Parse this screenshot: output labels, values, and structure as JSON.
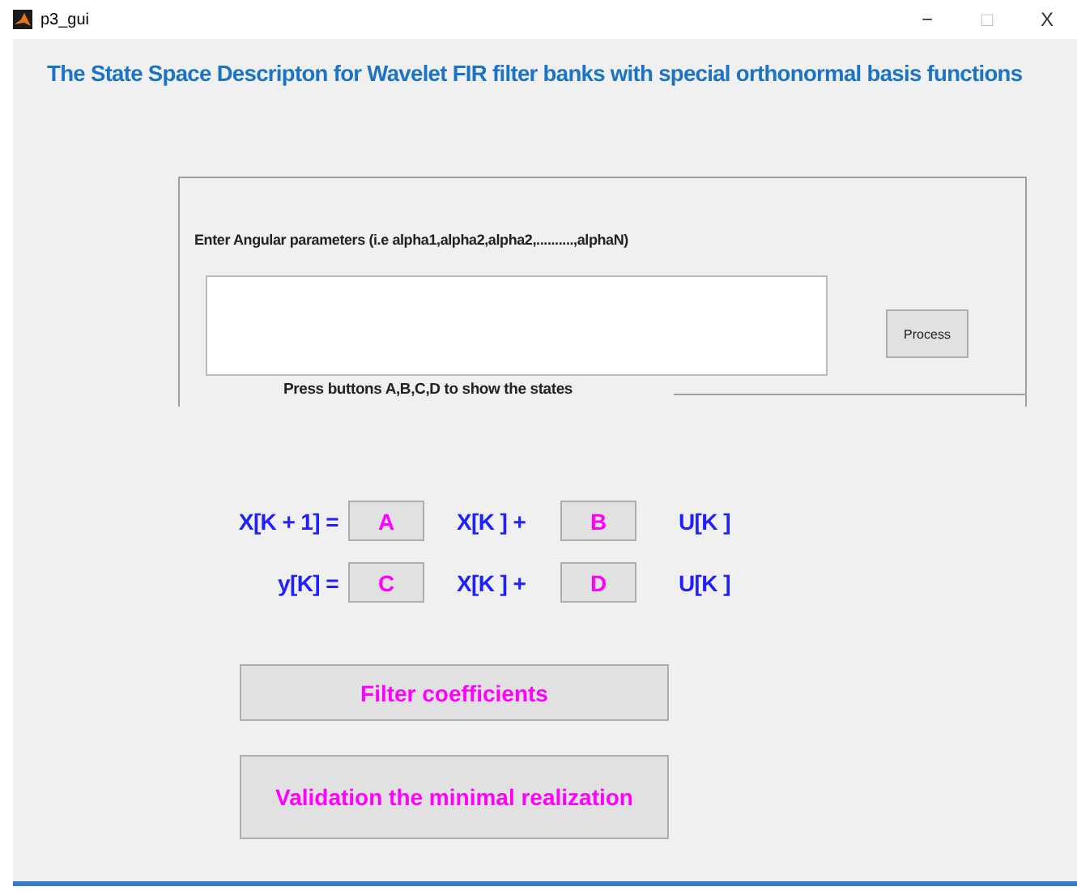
{
  "window": {
    "title": "p3_gui",
    "controls": [
      "−",
      "□",
      "X"
    ]
  },
  "heading": "The State Space Descripton for Wavelet FIR filter banks with special orthonormal basis functions",
  "panel": {
    "label": "Enter Angular parameters (i.e alpha1,alpha2,alpha2,..........,alphaN)",
    "process_button": "Process",
    "note": "Press buttons A,B,C,D to show the states"
  },
  "equations": [
    {
      "lhs": "X[K + 1] =",
      "button_1": "A",
      "middle": "X[K ]  +",
      "button_2": "B",
      "rhs": "U[K ]"
    },
    {
      "lhs": "y[K] =",
      "button_1": "C",
      "middle": "X[K ]  +",
      "button_2": "D",
      "rhs": "U[K ]"
    }
  ],
  "buttons": [
    "Filter coefficients",
    "Validation the minimal realization"
  ]
}
